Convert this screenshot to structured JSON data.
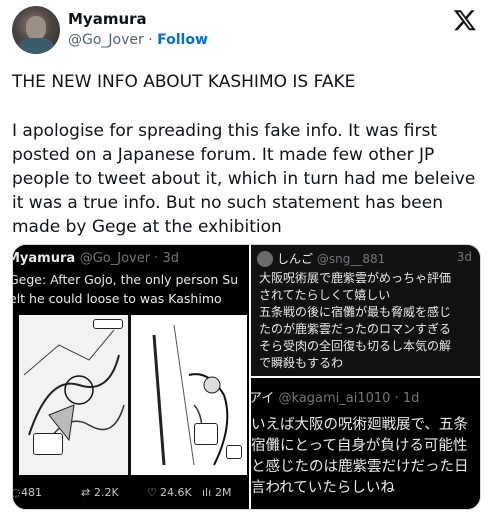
{
  "author": {
    "name": "Myamura",
    "handle": "@Go_Jover",
    "separator": "·",
    "follow_label": "Follow"
  },
  "tweet": {
    "headline": "THE NEW INFO ABOUT KASHIMO IS FAKE",
    "body": "I apologise for spreading this fake info. It was first posted on a Japanese forum. It made few other JP people to tweet about it, which in turn had me beleive it was a true info. But no such statement has been made by Gege at the exhibition"
  },
  "media": {
    "left": {
      "name": "Myamura",
      "handle": "@Go_Jover · 3d",
      "line1": "Gege: After Gojo, the only person Su",
      "line2": "elt he could loose to was Kashimo",
      "stats": {
        "replies": "481",
        "retweets": "2.2K",
        "likes": "24.6K",
        "views": "2M"
      }
    },
    "right_top": {
      "name": "しんご",
      "handle": "@sng__881",
      "time": "3d",
      "lines": [
        "大阪呪術展で鹿紫雲がめっちゃ評価",
        "されてたらしくて嬉しい",
        "五条戦の後に宿儺が最も脅威を感じ",
        "たのが鹿紫雲だったのロマンすぎる",
        "そら受肉の全回復も切るし本気の解",
        "で瞬殺もするわ"
      ]
    },
    "right_bottom": {
      "name": "アイ",
      "handle": "@kagami_ai1010 · 1d",
      "lines": [
        "いえば大阪の呪術廻戦展で、五条",
        "宿儺にとって自身が負ける可能性",
        "と感じたのは鹿紫雲だけだった日",
        "言われていたらしいね"
      ]
    }
  },
  "icons": {
    "x_logo": "x-logo-icon",
    "reply": "reply-icon",
    "retweet": "retweet-icon",
    "like": "heart-icon",
    "views": "views-icon"
  },
  "colors": {
    "follow": "#006fd6",
    "text": "#0f1419",
    "secondary": "#536471"
  }
}
